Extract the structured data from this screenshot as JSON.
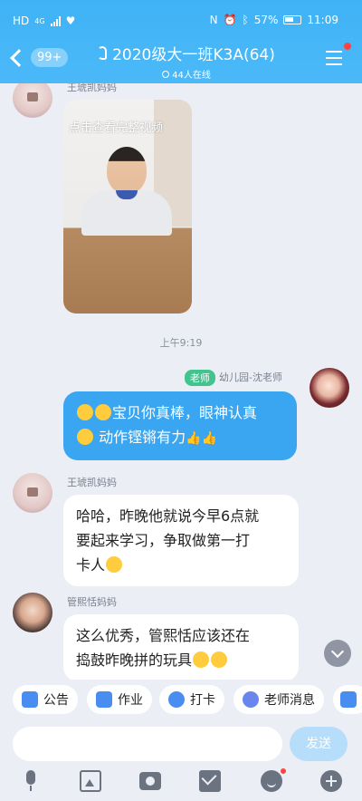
{
  "status": {
    "network": "HD",
    "net_type": "4G",
    "battery_percent": "57%",
    "time": "11:09"
  },
  "header": {
    "back_count": "99+",
    "title": "2020级大一班K3A(64)",
    "online": "44人在线"
  },
  "messages": [
    {
      "sender": "王琥凯妈妈",
      "type": "video",
      "caption": "点击查看完整视频"
    },
    {
      "timestamp": "上午9:19"
    },
    {
      "sender_tag": "老师",
      "sender": "幼儿园-沈老师",
      "text_line1": "宝贝你真棒，眼神认真",
      "text_line2": "动作铿锵有力"
    },
    {
      "sender": "王琥凯妈妈",
      "text_line1": "哈哈，昨晚他就说今早6点就",
      "text_line2": "要起来学习，争取做第一打",
      "text_line3": "卡人"
    },
    {
      "sender": "管熙恬妈妈",
      "text_line1": "这么优秀，管熙恬应该还在",
      "text_line2": "捣鼓昨晚拼的玩具"
    }
  ],
  "quickbar": {
    "notice": "公告",
    "homework": "作业",
    "checkin": "打卡",
    "teacher_msg": "老师消息"
  },
  "input": {
    "send": "发送"
  }
}
